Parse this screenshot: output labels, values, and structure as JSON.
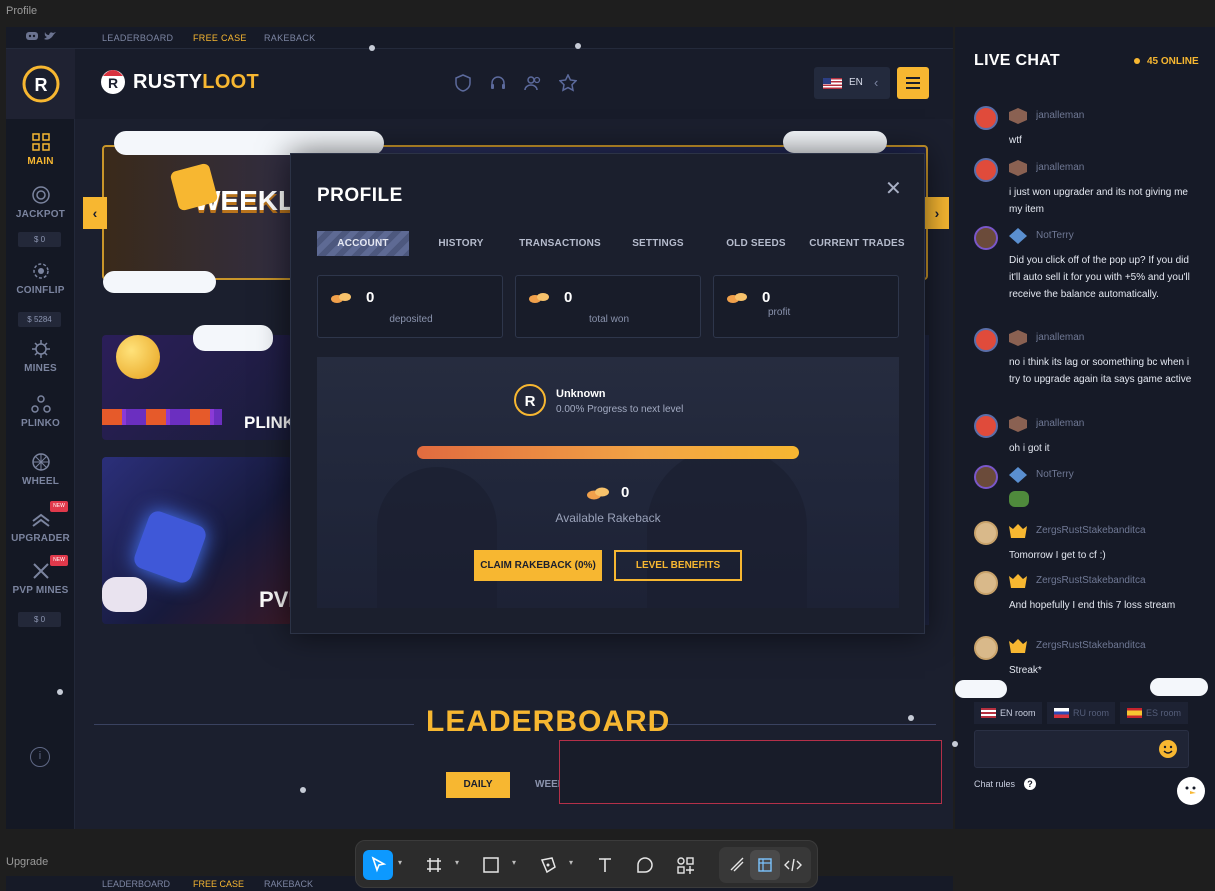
{
  "frames": {
    "top_label": "Profile",
    "bottom_label": "Upgrade"
  },
  "topbar": {
    "links": [
      "LEADERBOARD",
      "FREE CASE",
      "RAKEBACK"
    ],
    "social": [
      "discord-icon",
      "twitter-icon"
    ]
  },
  "brand": {
    "name_white": "RUSTY",
    "name_accent": "LOOT"
  },
  "sidebar": {
    "items": [
      {
        "label": "MAIN",
        "icon": "grid-icon",
        "active": true
      },
      {
        "label": "JACKPOT",
        "icon": "jackpot-icon",
        "value": "$ 0"
      },
      {
        "label": "COINFLIP",
        "icon": "coinflip-icon",
        "value": "$ 5284"
      },
      {
        "label": "MINES",
        "icon": "mines-icon"
      },
      {
        "label": "PLINKO",
        "icon": "plinko-icon"
      },
      {
        "label": "WHEEL",
        "icon": "wheel-icon",
        "badge": "NEW"
      },
      {
        "label": "UPGRADER",
        "icon": "upgrader-icon",
        "badge": "NEW"
      },
      {
        "label": "PVP MINES",
        "icon": "pvp-mines-icon",
        "value": "$ 0"
      }
    ]
  },
  "header": {
    "lang": "EN",
    "icons": [
      "shield-icon",
      "headset-icon",
      "users-icon",
      "star-icon"
    ]
  },
  "banners": {
    "weekly": "WEEKLY EVENTS",
    "plinko": "PLINKO",
    "pvp": "PVI"
  },
  "leaderboard": {
    "title": "LEADERBOARD",
    "tabs": [
      "DAILY",
      "WEEK"
    ]
  },
  "modal": {
    "title": "PROFILE",
    "tabs": [
      "ACCOUNT",
      "HISTORY",
      "TRANSACTIONS",
      "SETTINGS",
      "OLD SEEDS",
      "CURRENT TRADES"
    ],
    "active_tab": "ACCOUNT",
    "stats": [
      {
        "value": "0",
        "label": "deposited"
      },
      {
        "value": "0",
        "label": "total won"
      },
      {
        "value": "0",
        "label": "profit"
      }
    ],
    "user": {
      "name": "Unknown",
      "progress_text": "0.00% Progress to next level",
      "progress": 0
    },
    "rakeback": {
      "value": "0",
      "label": "Available Rakeback"
    },
    "buttons": {
      "claim": "CLAIM RAKEBACK (0%)",
      "benefits": "LEVEL BENEFITS"
    }
  },
  "chat": {
    "title": "LIVE CHAT",
    "online": "45 ONLINE",
    "messages": [
      {
        "name": "janalleman",
        "text": "wtf"
      },
      {
        "name": "janalleman",
        "text": "i just won upgrader and its not giving me my item"
      },
      {
        "name": "NotTerry",
        "text": "Did you click off of the pop up? If you did it'll auto sell it for you with +5% and you'll receive the balance automatically."
      },
      {
        "name": "janalleman",
        "text": "no i think its lag or soomething bc when i try to upgrade again ita says game active"
      },
      {
        "name": "janalleman",
        "text": "oh i got it"
      },
      {
        "name": "NotTerry",
        "text": ""
      },
      {
        "name": "ZergsRustStakebanditca",
        "text": "Tomorrow I get to cf :)"
      },
      {
        "name": "ZergsRustStakebanditca",
        "text": "And hopefully I end this 7 loss stream"
      },
      {
        "name": "ZergsRustStakebanditca",
        "text": "Streak*"
      }
    ],
    "rooms": [
      "EN room",
      "RU room",
      "ES room"
    ],
    "rules": "Chat rules",
    "rules_icon": "?"
  },
  "toolbar": {
    "tools": [
      "move-tool",
      "frame-tool",
      "rectangle-tool",
      "pen-tool",
      "text-tool",
      "comment-tool",
      "components-tool",
      "draw-mode",
      "design-mode",
      "dev-mode"
    ]
  },
  "colors": {
    "accent": "#f7b731",
    "bg": "#1b1f2e",
    "selection": "#0d99ff"
  }
}
